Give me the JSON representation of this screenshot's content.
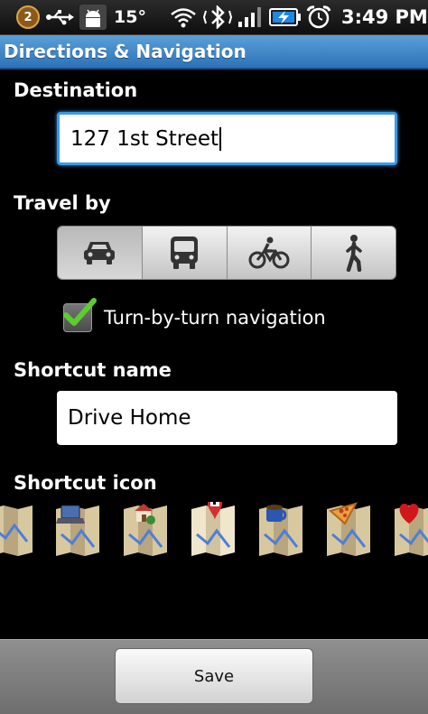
{
  "status_bar": {
    "notification_count": "2",
    "temperature": "15°",
    "time": "3:49 PM",
    "icons": [
      "notification-badge-icon",
      "usb-icon",
      "android-debug-icon",
      "wifi-icon",
      "bluetooth-icon",
      "signal-icon",
      "battery-charging-icon",
      "alarm-icon"
    ]
  },
  "title_bar": {
    "title": "Directions & Navigation"
  },
  "destination": {
    "label": "Destination",
    "value": "127 1st Street"
  },
  "travel_by": {
    "label": "Travel by",
    "modes": [
      {
        "name": "car-icon",
        "selected": true
      },
      {
        "name": "bus-icon",
        "selected": false
      },
      {
        "name": "bicycle-icon",
        "selected": false
      },
      {
        "name": "walk-icon",
        "selected": false
      }
    ]
  },
  "turn_by_turn": {
    "label": "Turn-by-turn navigation",
    "checked": true
  },
  "shortcut_name": {
    "label": "Shortcut name",
    "value": "Drive Home"
  },
  "shortcut_icon": {
    "label": "Shortcut icon",
    "icons": [
      "map-icon",
      "map-laptop-icon",
      "map-home-icon",
      "map-flag-pin-icon",
      "map-coffee-icon",
      "map-pizza-icon",
      "map-heart-icon"
    ]
  },
  "footer": {
    "save_label": "Save"
  },
  "colors": {
    "title_bar": "#3f8ccc",
    "focus": "#3b9ae8",
    "check": "#5ccd2e"
  }
}
